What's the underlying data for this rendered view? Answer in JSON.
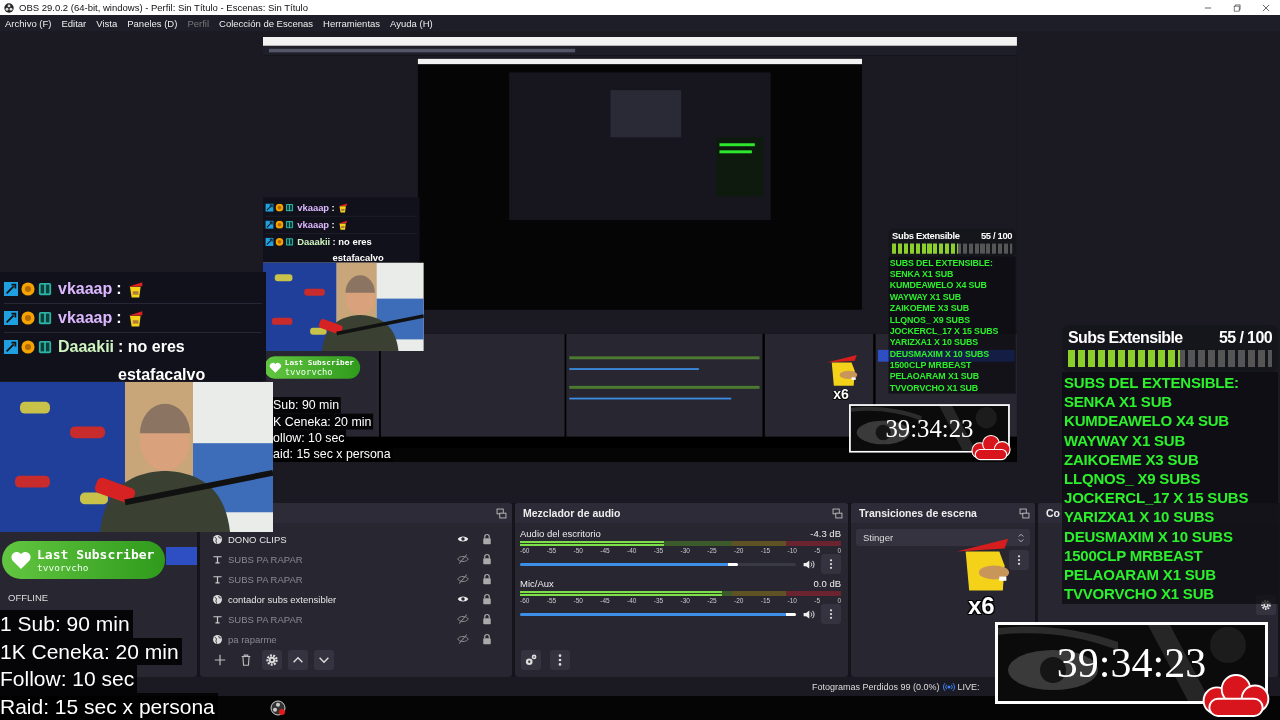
{
  "window": {
    "title": "OBS 29.0.2 (64-bit, windows) - Perfil: Sin Título - Escenas: Sin Título"
  },
  "menu": [
    {
      "label": "Archivo (F)",
      "disabled": false
    },
    {
      "label": "Editar",
      "disabled": false
    },
    {
      "label": "Vista",
      "disabled": false
    },
    {
      "label": "Paneles (D)",
      "disabled": false
    },
    {
      "label": "Perfil",
      "disabled": true
    },
    {
      "label": "Colección de Escenas",
      "disabled": false
    },
    {
      "label": "Herramientas",
      "disabled": false
    },
    {
      "label": "Ayuda (H)",
      "disabled": false
    }
  ],
  "preview": {
    "chat": [
      {
        "user": "vkaaap",
        "color": "#dcb8ff",
        "text": ":",
        "emote": true
      },
      {
        "user": "vkaaap",
        "color": "#dcb8ff",
        "text": ":",
        "emote": true
      },
      {
        "user": "Daaakii",
        "color": "#cff5bf",
        "text": ": no eres estafacalvo",
        "emote": false
      }
    ],
    "last_subscriber": {
      "label": "Last Subscriber",
      "name": "tvvorvcho"
    },
    "rules": [
      "Sub: 90 min",
      "K Ceneka: 20 min",
      "ollow: 10 sec",
      "aid: 15 sec x persona"
    ],
    "sticker": {
      "count": "x6"
    },
    "subs_widget": {
      "title": "Subs Extensible",
      "count": "55 / 100",
      "progress": {
        "level": 0.55
      },
      "lines": [
        "SUBS DEL EXTENSIBLE:",
        "SENKA X1 SUB",
        "KUMDEAWELO X4 SUB",
        "WAYWAY X1 SUB",
        "ZAIKOEME X3 SUB",
        "LLQNOS_ X9 SUBS",
        "JOCKERCL_17 X 15 SUBS",
        "YARIZXA1 X 10 SUBS",
        "DEUSMAXIM X 10 SUBS",
        "1500CLP MRBEAST",
        "PELAOARAM X1 SUB",
        "TVVORVCHO X1 SUB"
      ]
    },
    "timer": "39:34:23"
  },
  "scenes": [
    {
      "selected": true
    },
    {
      "label": "OFFLINE",
      "selected": false
    }
  ],
  "sources": [
    {
      "name": "DONO CLIPS",
      "kind": "browser",
      "visible": true,
      "locked": true
    },
    {
      "name": "SUBS PA RAPAR",
      "kind": "text",
      "visible": false,
      "locked": true
    },
    {
      "name": "SUBS PA RAPAR",
      "kind": "text",
      "visible": false,
      "locked": true
    },
    {
      "name": "contador subs extensibler",
      "kind": "browser",
      "visible": true,
      "locked": true
    },
    {
      "name": "SUBS PA RAPAR",
      "kind": "text",
      "visible": false,
      "locked": true
    },
    {
      "name": "pa raparme",
      "kind": "browser",
      "visible": false,
      "locked": true
    }
  ],
  "mixer": {
    "title": "Mezclador de audio",
    "channels": [
      {
        "name": "Audio del escritorio",
        "reading": "-4.3 dB",
        "meter": {
          "level": 0.45
        },
        "volume": {
          "level": 0.79
        },
        "scale": [
          "-60",
          "-55",
          "-50",
          "-45",
          "-40",
          "-35",
          "-30",
          "-25",
          "-20",
          "-15",
          "-10",
          "-5",
          "0"
        ]
      },
      {
        "name": "Mic/Aux",
        "reading": "0.0 dB",
        "meter": {
          "level": 0.63
        },
        "volume": {
          "level": 1
        },
        "scale": [
          "-60",
          "-55",
          "-50",
          "-45",
          "-40",
          "-35",
          "-30",
          "-25",
          "-20",
          "-15",
          "-10",
          "-5",
          "0"
        ]
      }
    ]
  },
  "transitions": {
    "title": "Transiciones de escena",
    "value": "Stinger"
  },
  "controls": {
    "title": "Co"
  },
  "status_bar": {
    "frames": "Fotogramas Perdidos 99 (0.0%)",
    "live": "LIVE:"
  },
  "chat": [
    {
      "user": "vkaaap",
      "color": "#dcb8ff",
      "text": ":",
      "emote": true
    },
    {
      "user": "vkaaap",
      "color": "#dcb8ff",
      "text": ":",
      "emote": true
    },
    {
      "user": "Daaakii",
      "color": "#cff5bf",
      "text": ": no eres estafacalvo",
      "emote": false
    }
  ],
  "last_subscriber": {
    "label": "Last Subscriber",
    "name": "tvvorvcho"
  },
  "rules": [
    "1 Sub: 90 min",
    "1K Ceneka: 20 min",
    "Follow: 10 sec",
    "Raid: 15 sec x persona"
  ],
  "sticker": {
    "count": "x6"
  },
  "subs_widget": {
    "title": "Subs Extensible",
    "count": "55 / 100",
    "progress": {
      "level": 0.55
    },
    "lines": [
      "SUBS DEL EXTENSIBLE:",
      "SENKA X1 SUB",
      "KUMDEAWELO X4 SUB",
      "WAYWAY X1 SUB",
      "ZAIKOEME X3 SUB",
      "LLQNOS_ X9 SUBS",
      "JOCKERCL_17 X 15 SUBS",
      "YARIZXA1 X 10 SUBS",
      "DEUSMAXIM X 10 SUBS",
      "1500CLP MRBEAST",
      "PELAOARAM X1 SUB",
      "TVVORVCHO X1 SUB"
    ]
  },
  "timer": "39:34:23"
}
